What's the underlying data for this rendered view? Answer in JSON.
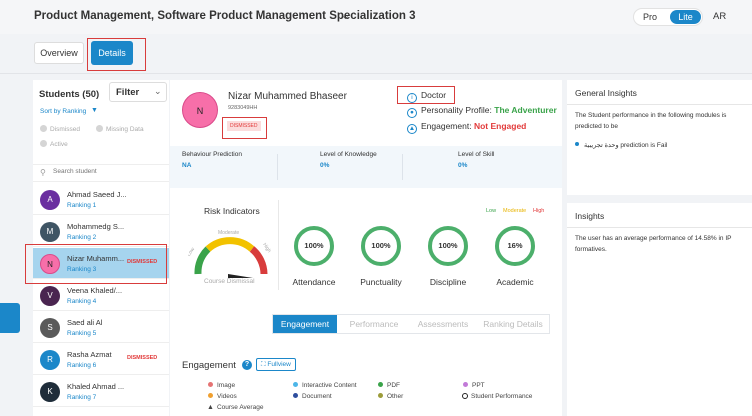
{
  "header": {
    "course_title": "Product Management, Software Product Management Specialization 3",
    "chevron_icon": "chevron-down-icon",
    "mode_pro": "Pro",
    "mode_lite": "Lite",
    "language": "AR"
  },
  "tabs": {
    "overview": "Overview",
    "details": "Details",
    "active": "Details"
  },
  "students": {
    "title": "Students (50)",
    "filter_label": "Filter",
    "sort_label": "Sort by Ranking",
    "options": {
      "dismissed": "Dismissed",
      "missing_data": "Missing Data",
      "active": "Active"
    },
    "search_placeholder": "Search student",
    "list": [
      {
        "initial": "A",
        "name": "Ahmad Saeed J...",
        "rank": "Ranking 1",
        "dismissed": "",
        "color": "#6a2ea0"
      },
      {
        "initial": "M",
        "name": "Mohammedg S...",
        "rank": "Ranking 2",
        "dismissed": "",
        "color": "#3f5564"
      },
      {
        "initial": "N",
        "name": "Nizar Muhamm...",
        "rank": "Ranking 3",
        "dismissed": "DISMISSED",
        "color": "#f76fa9"
      },
      {
        "initial": "V",
        "name": "Veena Khaled/...",
        "rank": "Ranking 4",
        "dismissed": "",
        "color": "#4a2550"
      },
      {
        "initial": "S",
        "name": "Saed ali Al",
        "rank": "Ranking 5",
        "dismissed": "",
        "color": "#5a5a5a"
      },
      {
        "initial": "R",
        "name": "Rasha Azmat",
        "rank": "Ranking 6",
        "dismissed": "DISMISSED",
        "color": "#1b87c9"
      },
      {
        "initial": "K",
        "name": "Khaled Ahmad ...",
        "rank": "Ranking 7",
        "dismissed": "",
        "color": "#1f2d3a"
      }
    ]
  },
  "profile": {
    "initial": "N",
    "name": "Nizar Muhammed Bhaseer",
    "id": "9283049HH",
    "status": "DISMISSED",
    "role": "Doctor",
    "personality_label": "Personality Profile:",
    "personality_value": "The Adventurer",
    "engagement_label": "Engagement:",
    "engagement_value": "Not Engaged"
  },
  "metrics": [
    {
      "label": "Behaviour Prediction",
      "value": "NA"
    },
    {
      "label": "Level of Knowledge",
      "value": "0%"
    },
    {
      "label": "Level of Skill",
      "value": "0%"
    }
  ],
  "risk": {
    "title": "Risk Indicators",
    "gauge_low": "Low",
    "gauge_moderate": "Moderate",
    "gauge_high": "High",
    "gauge_caption": "Course Dismissal",
    "legend_low": "Low",
    "legend_moderate": "Moderate",
    "legend_high": "High",
    "indicators": [
      {
        "label": "Attendance",
        "value": "100%"
      },
      {
        "label": "Punctuality",
        "value": "100%"
      },
      {
        "label": "Discipline",
        "value": "100%"
      },
      {
        "label": "Academic",
        "value": "16%"
      }
    ]
  },
  "subtabs": [
    "Engagement",
    "Performance",
    "Assessments",
    "Ranking Details"
  ],
  "engagement": {
    "title": "Engagement",
    "fullview": "Fullview",
    "legend": [
      {
        "label": "Image",
        "color": "#e57373",
        "shape": "dot"
      },
      {
        "label": "Interactive Content",
        "color": "#4db6e8",
        "shape": "dot"
      },
      {
        "label": "PDF",
        "color": "#3aa34a",
        "shape": "dot"
      },
      {
        "label": "PPT",
        "color": "#c27ad8",
        "shape": "dot"
      },
      {
        "label": "Videos",
        "color": "#f0a030",
        "shape": "dot"
      },
      {
        "label": "Document",
        "color": "#2e4e9e",
        "shape": "dot"
      },
      {
        "label": "Other",
        "color": "#9c9c3a",
        "shape": "dot"
      },
      {
        "label": "Student Performance",
        "color": "#222222",
        "shape": "ring"
      },
      {
        "label": "Course Average",
        "color": "#222222",
        "shape": "triangle"
      }
    ]
  },
  "general_insights": {
    "title": "General Insights",
    "text": "The Student performance in the following modules is predicted to be",
    "bullet": "وحدة تجريبية prediction is Fail"
  },
  "insights": {
    "title": "Insights",
    "text": "The user has an average performance of 14.58% in IP formatives."
  }
}
